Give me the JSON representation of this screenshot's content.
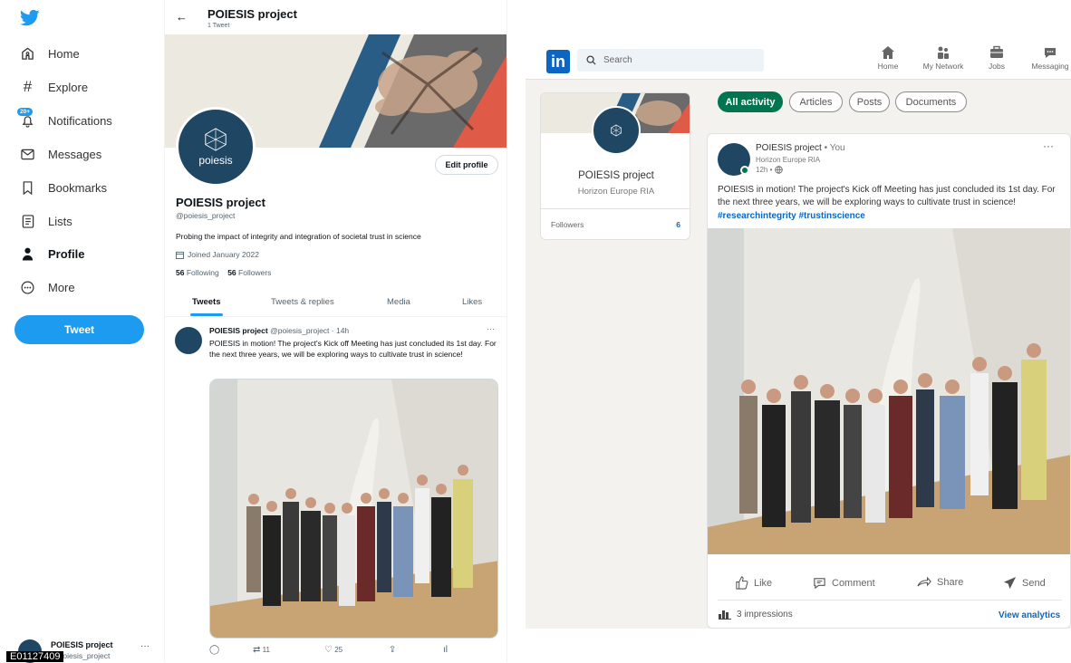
{
  "twitter": {
    "sidebar": {
      "items": [
        {
          "label": "Home",
          "icon": "home-icon"
        },
        {
          "label": "Explore",
          "icon": "hashtag-icon"
        },
        {
          "label": "Notifications",
          "icon": "bell-icon",
          "badge": "20+"
        },
        {
          "label": "Messages",
          "icon": "mail-icon"
        },
        {
          "label": "Bookmarks",
          "icon": "bookmark-icon"
        },
        {
          "label": "Lists",
          "icon": "list-icon"
        },
        {
          "label": "Profile",
          "icon": "person-icon"
        },
        {
          "label": "More",
          "icon": "more-circle-icon"
        }
      ],
      "tweet_button": "Tweet",
      "account": {
        "name": "POIESIS project",
        "handle": "@poiesis_project"
      }
    },
    "header": {
      "title": "POIESIS project",
      "subtitle": "1 Tweet"
    },
    "profile": {
      "avatar_text": "poiesis",
      "edit_button": "Edit profile",
      "name": "POIESIS project",
      "handle": "@poiesis_project",
      "bio": "Probing the impact of integrity and integration of societal trust in science",
      "joined": "Joined January 2022",
      "following_count": "56",
      "following_label": "Following",
      "followers_count": "56",
      "followers_label": "Followers"
    },
    "tabs": [
      "Tweets",
      "Tweets & replies",
      "Media",
      "Likes"
    ],
    "tweet": {
      "author": "POIESIS project",
      "meta": "@poiesis_project · 14h",
      "more": "···",
      "text": "POIESIS in motion! The project's Kick off Meeting has just concluded its 1st day. For the next three years, we will be exploring ways to cultivate trust in science!",
      "retweets": "11",
      "likes": "25"
    }
  },
  "linkedin": {
    "search_placeholder": "Search",
    "nav": [
      {
        "label": "Home",
        "icon": "home-icon"
      },
      {
        "label": "My Network",
        "icon": "network-icon"
      },
      {
        "label": "Jobs",
        "icon": "briefcase-icon"
      },
      {
        "label": "Messaging",
        "icon": "message-icon"
      }
    ],
    "card": {
      "name": "POIESIS project",
      "subtitle": "Horizon Europe RIA",
      "followers_label": "Followers",
      "followers_count": "6"
    },
    "filters": [
      "All activity",
      "Articles",
      "Posts",
      "Documents"
    ],
    "post": {
      "author": "POIESIS project",
      "you": "• You",
      "org": "Horizon Europe RIA",
      "time": "12h •",
      "more": "···",
      "text": "POIESIS in motion! The project's Kick off Meeting has just concluded its 1st day. For the next three years, we will be exploring ways to cultivate trust in science!",
      "hashtags": "#researchintegrity #trustinscience",
      "actions": [
        "Like",
        "Comment",
        "Share",
        "Send"
      ],
      "impressions": "3 impressions",
      "analytics": "View analytics"
    }
  },
  "overlay_text": "E01127409"
}
